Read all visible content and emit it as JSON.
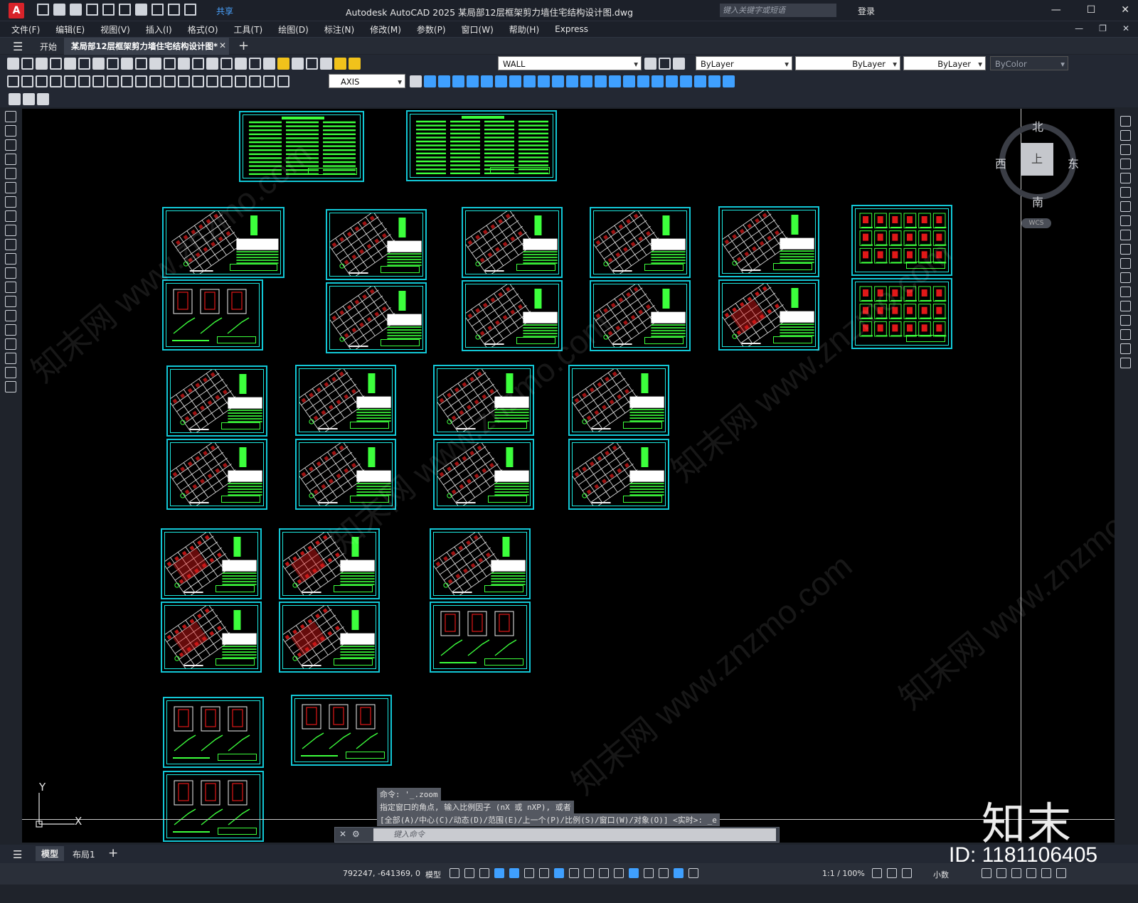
{
  "app": {
    "title": "Autodesk AutoCAD 2025    某局部12层框架剪力墙住宅结构设计图.dwg",
    "share_label": "共享",
    "search_placeholder": "键入关键字或短语",
    "login_label": "登录",
    "logo_letter": "A"
  },
  "menu": [
    "文件(F)",
    "编辑(E)",
    "视图(V)",
    "插入(I)",
    "格式(O)",
    "工具(T)",
    "绘图(D)",
    "标注(N)",
    "修改(M)",
    "参数(P)",
    "窗口(W)",
    "帮助(H)",
    "Express"
  ],
  "tabs": {
    "start": "开始",
    "active": "某局部12层框架剪力墙住宅结构设计图*"
  },
  "toolbar": {
    "layer": "WALL",
    "color": "ByLayer",
    "linetype": "ByLayer",
    "lineweight": "ByLayer",
    "plotstyle": "ByColor",
    "dimstyle": "AXIS"
  },
  "viewcube": {
    "north": "北",
    "south": "南",
    "east": "东",
    "west": "西",
    "top": "上",
    "wcs": "WCS"
  },
  "ucs": {
    "y": "Y",
    "x": "X"
  },
  "command": {
    "line1": "命令: '_.zoom",
    "line2": "指定窗口的角点, 输入比例因子 (nX 或 nXP), 或者",
    "line3": "[全部(A)/中心(C)/动态(D)/范围(E)/上一个(P)/比例(S)/窗口(W)/对象(O)] <实时>: _e",
    "placeholder": "键入命令"
  },
  "layout_tabs": [
    "模型",
    "布局1"
  ],
  "status": {
    "coords": "792247, -641369, 0",
    "model": "模型",
    "scale": "1:1 / 100%",
    "units": "小数"
  },
  "watermark": {
    "logo": "知末",
    "id": "ID: 1181106405",
    "diag": "知末网 www.znzmo.com"
  },
  "colors": {
    "sheet_border": "#12c7d6",
    "drawing_green": "#3cff3c",
    "drawing_red": "#e01818",
    "canvas": "#000000",
    "accent": "#3fa0ff"
  }
}
